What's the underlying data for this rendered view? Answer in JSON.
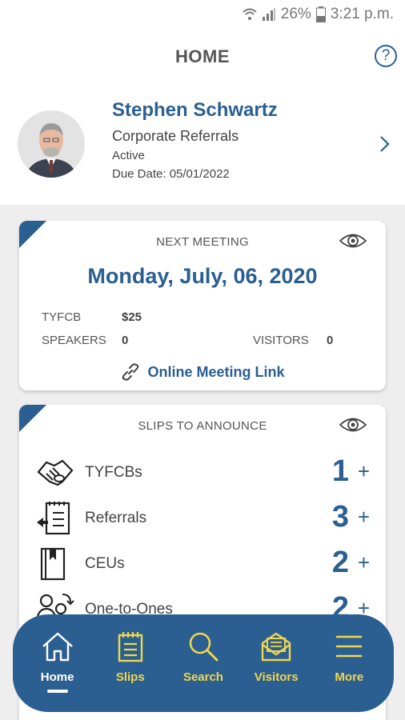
{
  "status_bar": {
    "battery": "26%",
    "time": "3:21 p.m."
  },
  "header": {
    "title": "HOME",
    "help_icon": "help-circle-icon"
  },
  "profile": {
    "name": "Stephen Schwartz",
    "company": "Corporate Referrals",
    "status": "Active",
    "due_date": "Due Date: 05/01/2022"
  },
  "next_meeting": {
    "label": "NEXT MEETING",
    "date": "Monday, July, 06, 2020",
    "tyfcb_label": "TYFCB",
    "tyfcb_value": "$25",
    "speakers_label": "SPEAKERS",
    "speakers_value": "0",
    "visitors_label": "VISITORS",
    "visitors_value": "0",
    "link_text": "Online Meeting Link"
  },
  "slips": {
    "label": "SLIPS TO ANNOUNCE",
    "items": [
      {
        "label": "TYFCBs",
        "count": "1",
        "icon": "handshake-icon"
      },
      {
        "label": "Referrals",
        "count": "3",
        "icon": "referral-list-icon"
      },
      {
        "label": "CEUs",
        "count": "2",
        "icon": "book-icon"
      },
      {
        "label": "One-to-Ones",
        "count": "2",
        "icon": "people-exchange-icon"
      }
    ]
  },
  "nav": {
    "items": [
      {
        "label": "Home",
        "icon": "home-icon"
      },
      {
        "label": "Slips",
        "icon": "clipboard-icon"
      },
      {
        "label": "Search",
        "icon": "search-icon"
      },
      {
        "label": "Visitors",
        "icon": "envelope-icon"
      },
      {
        "label": "More",
        "icon": "menu-icon"
      }
    ]
  },
  "colors": {
    "brand_blue": "#2b5f91",
    "nav_accent": "#f0d64a",
    "background_gray": "#eeeeee"
  }
}
